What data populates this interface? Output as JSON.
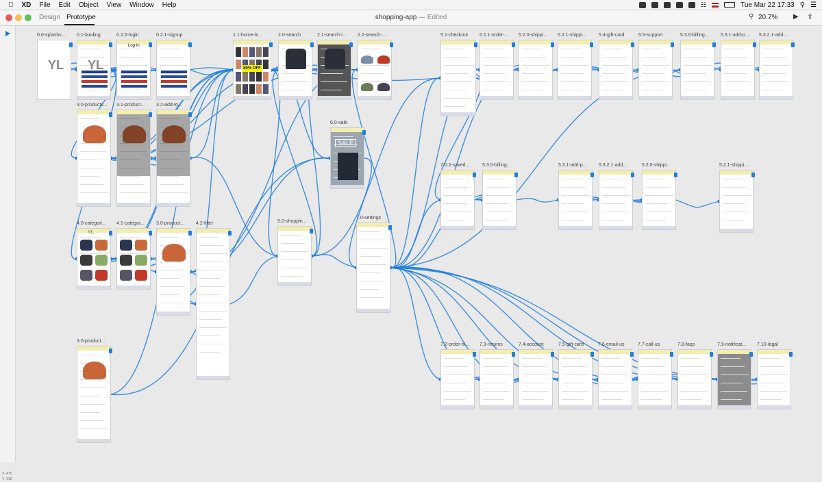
{
  "menubar": {
    "app_name": "XD",
    "items": [
      "File",
      "Edit",
      "Object",
      "View",
      "Window",
      "Help"
    ],
    "clock": "Tue Mar 22  17:33"
  },
  "titlebar": {
    "tabs": [
      "Design",
      "Prototype"
    ],
    "active_tab": "Prototype",
    "document": "shopping-app",
    "status": " — Edited",
    "zoom": "20.7%"
  },
  "status": {
    "x_readout": "X  -470",
    "y_readout": "Y  -119"
  },
  "artboards": [
    "0.0-splashs...",
    "0.1-landing",
    "0.2.0-login",
    "0.2.1-signup",
    "1.1-home-lo...",
    "2.0-search",
    "2.1-search-i...",
    "2.2-search-...",
    "5.1-checkout",
    "5.1.1-order-...",
    "5.2.0-shippi...",
    "5.2.1-shippi...",
    "5.4-gift-card",
    "5.5-support",
    "5.3.0-billing...",
    "5.3.1-add-p...",
    "5.3.2.1-add...",
    "3.0-products...",
    "3.1-product...",
    "3.2-add-to...",
    "6.0-sale",
    "7.0.2-saved...",
    "5.3.0-billing...",
    "5.3.1-add-p...",
    "5.3.2.1-add...",
    "5.2.0-shippi...",
    "5.2.1-shippi...",
    "4.0-categori...",
    "4.1-categor...",
    "3.0-product...",
    "4.2-filter",
    "5.0-shoppin...",
    "7.0-settings",
    "3.0-product...",
    "7.2-order-hi...",
    "7.3-returns",
    "7.4-account",
    "7.5-gift card",
    "7.6-email-us",
    "7.7-call-us",
    "7.8-faqs",
    "7.9-notificat...",
    "7.10-legal"
  ],
  "content": {
    "logo": "YL",
    "login_title": "Log In",
    "sale_banner": "80% OFF",
    "sale_text": "SALE"
  },
  "colors": {
    "wire": "#1f7fe0",
    "header": "#f3edb0",
    "accent": "#1473e6"
  }
}
